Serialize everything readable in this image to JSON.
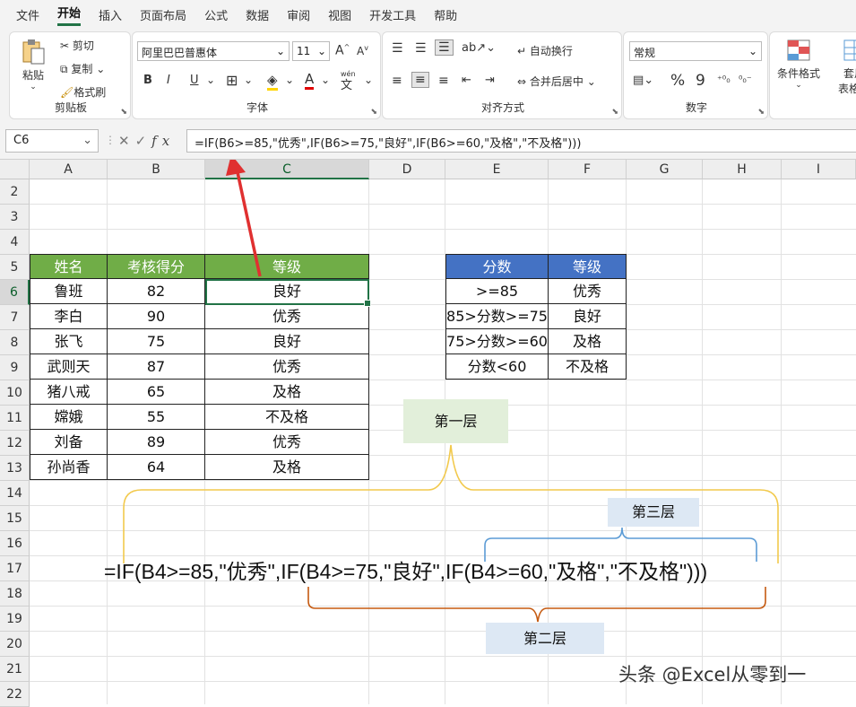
{
  "menu": [
    "文件",
    "开始",
    "插入",
    "页面布局",
    "公式",
    "数据",
    "审阅",
    "视图",
    "开发工具",
    "帮助"
  ],
  "menu_active": "开始",
  "ribbon": {
    "clipboard": {
      "paste": "粘贴",
      "cut": "剪切",
      "copy": "复制",
      "format_painter": "格式刷",
      "label": "剪贴板"
    },
    "font": {
      "name": "阿里巴巴普惠体",
      "size": "11",
      "bold": "B",
      "italic": "I",
      "underline": "U",
      "font_color": "A",
      "phonetic": "wén",
      "label": "字体",
      "grow": "A",
      "shrink": "A"
    },
    "alignment": {
      "wrap": "自动换行",
      "merge": "合并后居中",
      "label": "对齐方式"
    },
    "number": {
      "format": "常规",
      "percent": "%",
      "comma": "9",
      "label": "数字"
    },
    "styles": {
      "conditional": "条件格式",
      "table_fmt_1": "套用",
      "table_fmt_2": "表格格"
    }
  },
  "formula_bar": {
    "name_box": "C6",
    "fx": "fx",
    "formula": "=IF(B6>=85,\"优秀\",IF(B6>=75,\"良好\",IF(B6>=60,\"及格\",\"不及格\")))"
  },
  "columns": [
    "A",
    "B",
    "C",
    "D",
    "E",
    "F",
    "G",
    "H",
    "I"
  ],
  "rows": [
    "2",
    "3",
    "4",
    "5",
    "6",
    "7",
    "8",
    "9",
    "10",
    "11",
    "12",
    "13",
    "14",
    "15",
    "16",
    "17",
    "18",
    "19",
    "20",
    "21",
    "22"
  ],
  "table1": {
    "headers": [
      "姓名",
      "考核得分",
      "等级"
    ],
    "rows": [
      [
        "鲁班",
        "82",
        "良好"
      ],
      [
        "李白",
        "90",
        "优秀"
      ],
      [
        "张飞",
        "75",
        "良好"
      ],
      [
        "武则天",
        "87",
        "优秀"
      ],
      [
        "猪八戒",
        "65",
        "及格"
      ],
      [
        "嫦娥",
        "55",
        "不及格"
      ],
      [
        "刘备",
        "89",
        "优秀"
      ],
      [
        "孙尚香",
        "64",
        "及格"
      ]
    ]
  },
  "table2": {
    "headers": [
      "分数",
      "等级"
    ],
    "rows": [
      [
        ">=85",
        "优秀"
      ],
      [
        "85>分数>=75",
        "良好"
      ],
      [
        "75>分数>=60",
        "及格"
      ],
      [
        "分数<60",
        "不及格"
      ]
    ]
  },
  "annotations": {
    "layer1": "第一层",
    "layer2": "第二层",
    "layer3": "第三层",
    "formula": "=IF(B4>=85,\"优秀\",IF(B4>=75,\"良好\",IF(B4>=60,\"及格\",\"不及格\")))"
  },
  "watermark": "头条 @Excel从零到一",
  "colors": {
    "green_header": "#70ad47",
    "blue_header": "#4472c4",
    "layer1_bg": "#e2efda",
    "layer_bg": "#dde8f4",
    "bracket_yellow": "#f2c94c",
    "bracket_blue": "#5b9bd5",
    "bracket_orange": "#c55a11",
    "arrow_red": "#e03030"
  }
}
